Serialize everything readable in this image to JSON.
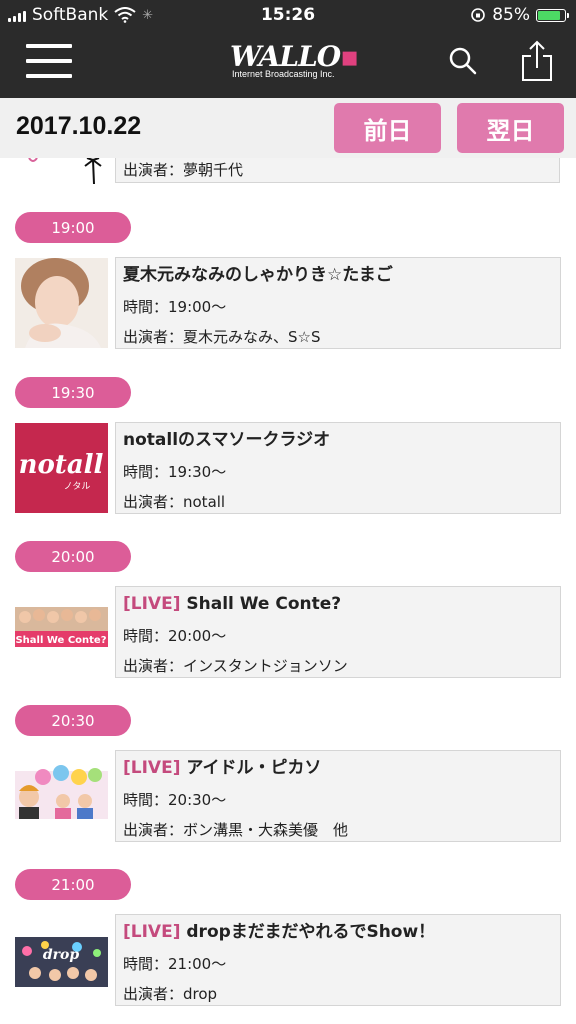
{
  "status_bar": {
    "carrier": "SoftBank",
    "time": "15:26",
    "battery": "85%",
    "battery_level": 0.85
  },
  "header": {
    "logo_text": "WALLO",
    "logo_sub": "Internet Broadcasting Inc.",
    "menu_icon": "hamburger-icon",
    "search_icon": "search-icon",
    "share_icon": "share-icon"
  },
  "datebar": {
    "date": "2017.10.22",
    "prev_label": "前日",
    "next_label": "翌日"
  },
  "partial_item": {
    "performers": "出演者：夢朝千代"
  },
  "slots": [
    {
      "time_pill": "19:00",
      "live": "",
      "title": "夏木元みなみのしゃかりき☆たまご",
      "time": "時間：19:00〜",
      "performers": "出演者：夏木元みなみ、S☆S"
    },
    {
      "time_pill": "19:30",
      "live": "",
      "title": "notallのスマソークラジオ",
      "time": "時間：19:30〜",
      "performers": "出演者：notall"
    },
    {
      "time_pill": "20:00",
      "live": "[LIVE]",
      "title": "Shall We Conte?",
      "time": "時間：20:00〜",
      "performers": "出演者：インスタントジョンソン"
    },
    {
      "time_pill": "20:30",
      "live": "[LIVE]",
      "title": "アイドル・ピカソ",
      "time": "時間：20:30〜",
      "performers": "出演者：ボン溝黒・大森美優　他"
    },
    {
      "time_pill": "21:00",
      "live": "[LIVE]",
      "title": "dropまだまだやれるでShow！",
      "time": "時間：21:00〜",
      "performers": "出演者：drop"
    }
  ],
  "thumb_text": {
    "notall": "notall",
    "notall_kana": "ノタル",
    "conte": "Shall We Conte?",
    "drop": "drop"
  },
  "colors": {
    "header_bg": "#2b2b2b",
    "pink_button": "#e07aad",
    "pink_pill": "#dc5d98",
    "live_text": "#c44a7d"
  }
}
